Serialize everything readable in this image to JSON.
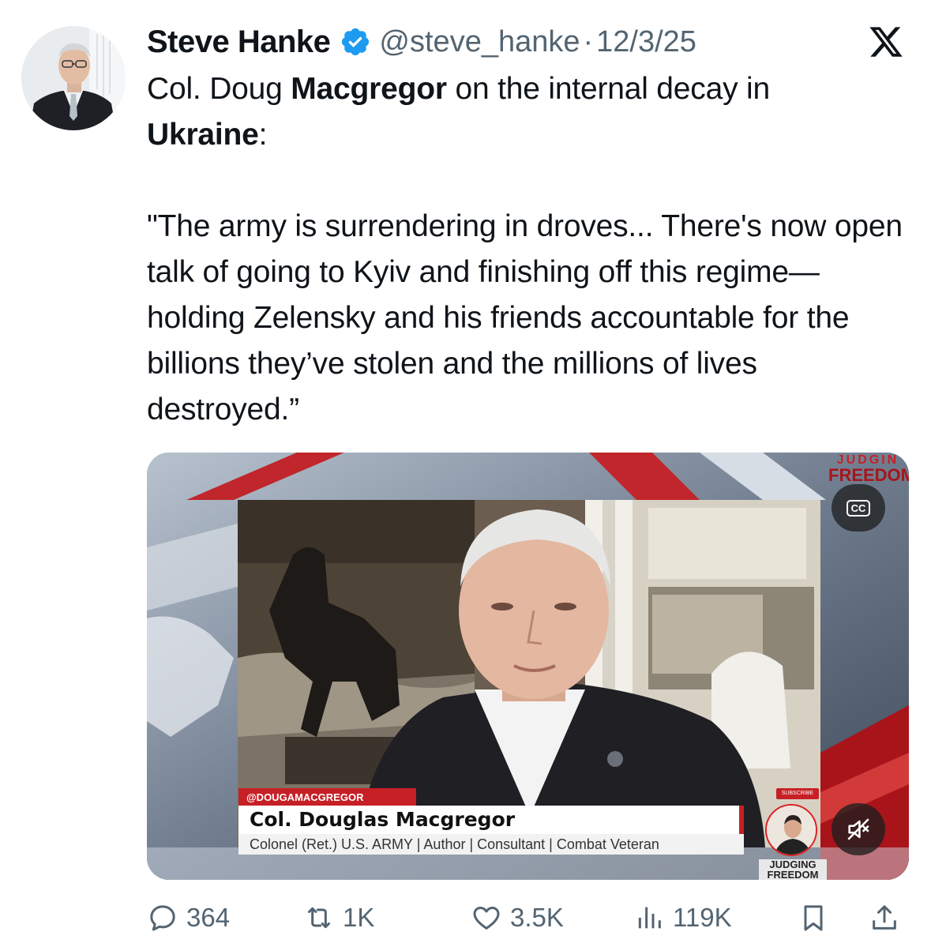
{
  "tweet": {
    "author_name": "Steve Hanke",
    "handle": "@steve_hanke",
    "separator": "·",
    "date": "12/3/25",
    "text_before_1": "Col. Doug ",
    "text_bold_1": "Macgregor",
    "text_after_1": " on the internal decay in",
    "text_bold_2": "Ukraine",
    "text_after_2": ":",
    "quote": "\"The army is surrendering in droves... There's now open talk of going to Kyiv and finishing off this regime—holding Zelensky and his friends accountable for the billions they’ve stolen and the millions of lives destroyed.”"
  },
  "media": {
    "handle_tag": "@DOUGAMACGREGOR",
    "guest_name": "Col. Douglas Macgregor",
    "guest_title": "Colonel (Ret.) U.S. ARMY | Author | Consultant | Combat Veteran",
    "brand_top_1": "JUDGIN",
    "brand_top_2": "FREEDOM",
    "cc_label": "CC",
    "subscribe_label": "SUBSCRIBE",
    "badge_label": "JUDGING FREEDOM"
  },
  "actions": {
    "replies": "364",
    "reposts": "1K",
    "likes": "3.5K",
    "views": "119K"
  },
  "icons": {
    "verified": "verified-badge-icon",
    "x_logo": "x-logo-icon",
    "reply": "reply-icon",
    "repost": "repost-icon",
    "like": "heart-icon",
    "views": "views-icon",
    "bookmark": "bookmark-icon",
    "share": "share-icon",
    "cc": "closed-captions-icon",
    "mute": "mute-icon"
  },
  "colors": {
    "verified_blue": "#1d9bf0",
    "muted_text": "#536471",
    "brand_red": "#c62026"
  }
}
